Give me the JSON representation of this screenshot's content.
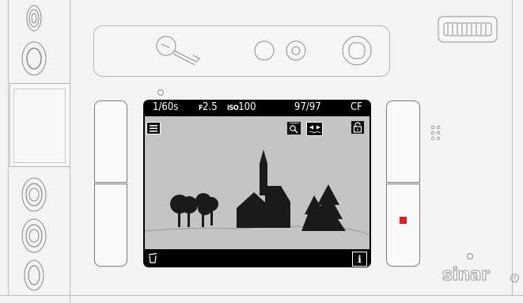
{
  "status_bar": {
    "shutter": "1/60s",
    "aperture_prefix": "F",
    "aperture": "2.5",
    "iso_label": "ISO",
    "iso_value": "100",
    "frames": "97/97",
    "card": "CF"
  },
  "icons": {
    "menu": "hamburger-menu-icon",
    "zoom": "magnifier-icon",
    "focus": "focus-arrows-icon",
    "lock": "padlock-icon",
    "delete": "trash-icon",
    "info": "info-icon",
    "info_glyph": "i"
  },
  "brand": {
    "logo_text": "sinar",
    "registered": "®"
  },
  "colors": {
    "record_indicator": "#e02020",
    "lcd_background": "#c4c4c4",
    "silhouette": "#1a1a1a"
  }
}
